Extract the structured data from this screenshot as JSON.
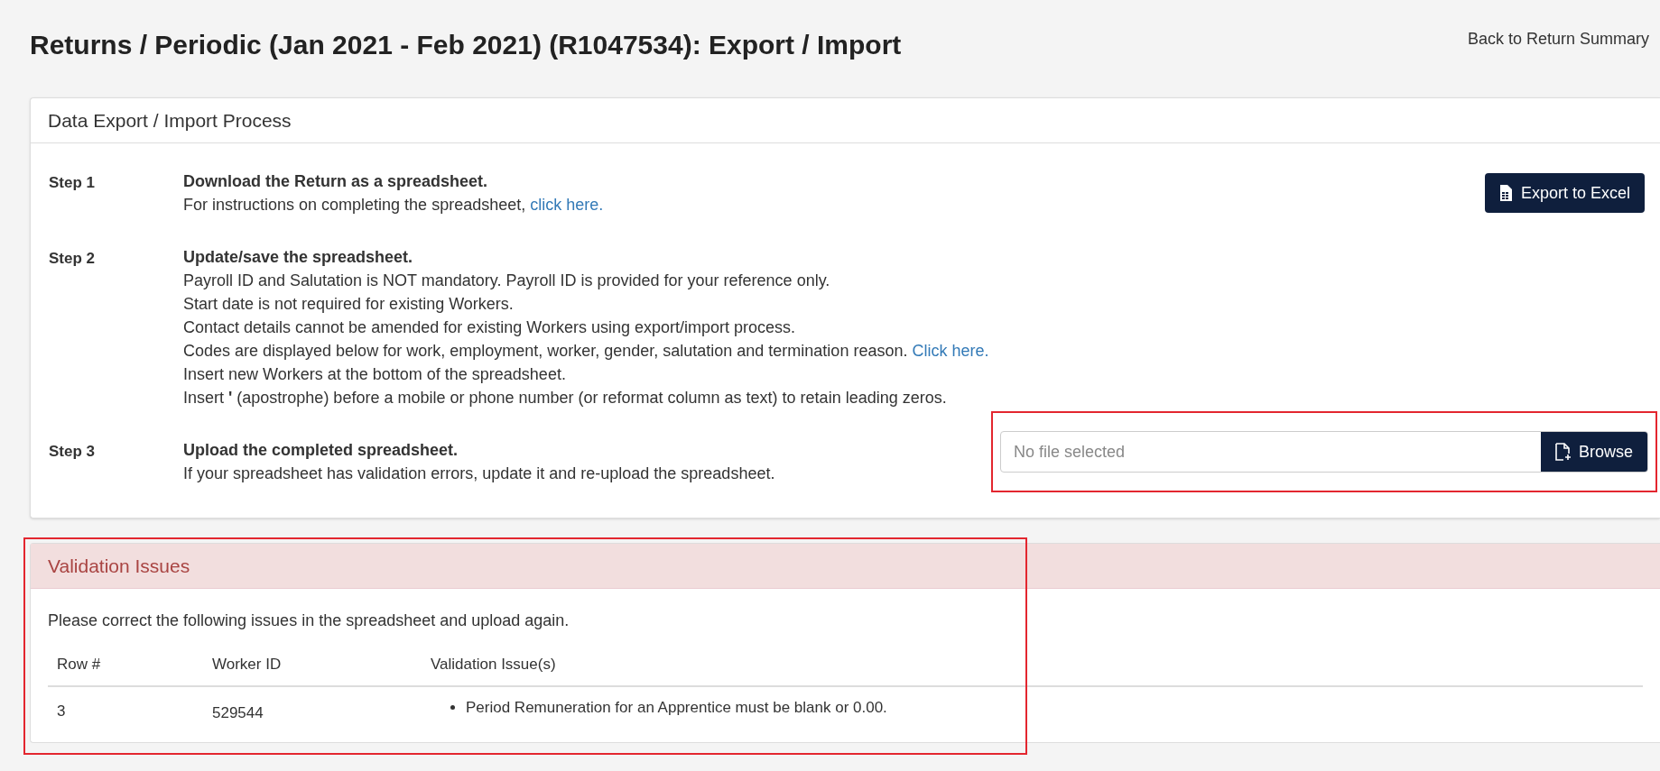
{
  "title": "Returns / Periodic (Jan 2021 - Feb 2021) (R1047534): Export / Import",
  "back_link": "Back to Return Summary",
  "process_panel": {
    "heading": "Data Export / Import Process",
    "steps": [
      {
        "label": "Step 1",
        "heading": "Download the Return as a spreadsheet.",
        "lines": [
          {
            "text": "For instructions on completing the spreadsheet,",
            "link": "click here."
          }
        ],
        "action": {
          "kind": "button",
          "label": "Export to Excel"
        }
      },
      {
        "label": "Step 2",
        "heading": "Update/save the spreadsheet.",
        "lines": [
          "Payroll ID and Salutation is NOT mandatory. Payroll ID is provided for your reference only.",
          "Start date is not required for existing Workers.",
          "Contact details cannot be amended for existing Workers using export/import process.",
          {
            "text": "Codes are displayed below for work, employment, worker, gender, salutation and termination reason.",
            "link": "Click here."
          },
          "Insert new Workers at the bottom of the spreadsheet.",
          "Insert **'** (apostrophe) before a mobile or phone number (or reformat column as text) to retain leading zeros."
        ]
      },
      {
        "label": "Step 3",
        "heading": "Upload the completed spreadsheet.",
        "lines": [
          "If your spreadsheet has validation errors, update it and re-upload the spreadsheet."
        ],
        "action": {
          "kind": "file",
          "placeholder": "No file selected",
          "label": "Browse",
          "highlighted": true
        }
      }
    ]
  },
  "validation_panel": {
    "heading": "Validation Issues",
    "highlighted": true,
    "intro": "Please correct the following issues in the spreadsheet and upload again.",
    "columns": [
      "Row #",
      "Worker ID",
      "Validation Issue(s)"
    ],
    "rows": [
      {
        "row": "3",
        "worker_id": "529544",
        "issues": [
          "Period Remuneration for an Apprentice must be blank or 0.00."
        ]
      }
    ]
  }
}
